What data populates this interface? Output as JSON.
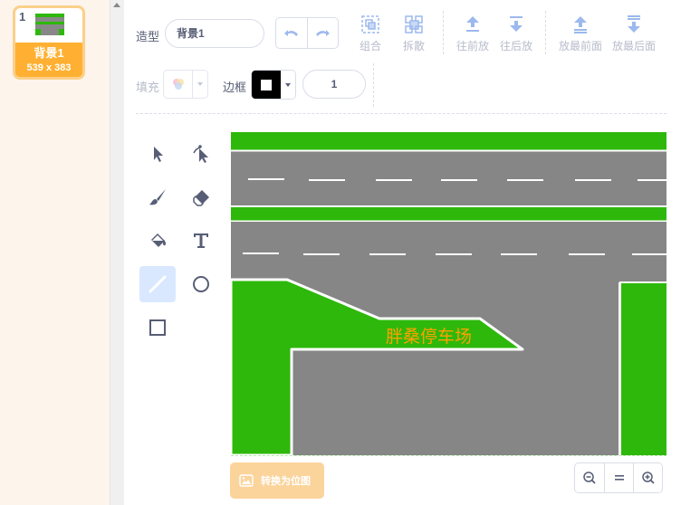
{
  "costume": {
    "index": "1",
    "name": "背景1",
    "size": "539 x 383"
  },
  "toolbar": {
    "costume_label": "造型",
    "costume_name": "背景1",
    "group_label": "组合",
    "ungroup_label": "拆散",
    "forward_label": "往前放",
    "backward_label": "往后放",
    "front_label": "放最前面",
    "back_label": "放最后面",
    "fill_label": "填充",
    "outline_label": "边框",
    "outline_width": "1"
  },
  "canvas": {
    "parking_label": "胖桑停车场"
  },
  "footer": {
    "convert_label": "转换为位图"
  },
  "colors": {
    "grass": "#2eb80b",
    "road": "#868686",
    "accent": "#855cd6",
    "costume_selected": "#ffb032",
    "parking_text": "#ffa000"
  }
}
